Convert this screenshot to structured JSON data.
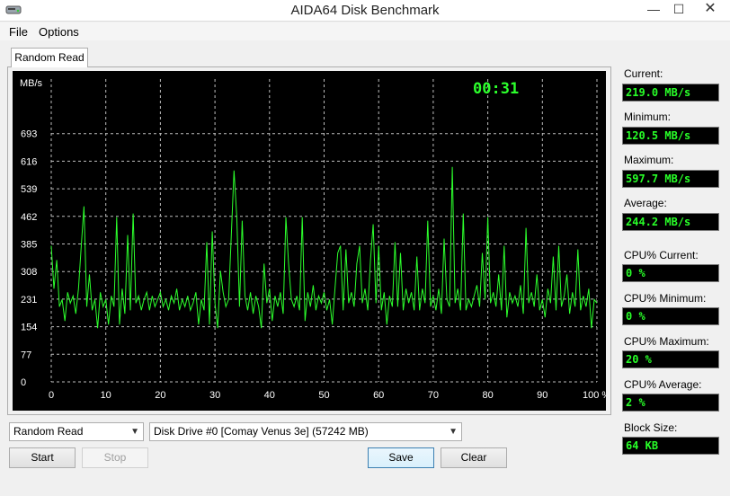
{
  "window": {
    "title": "AIDA64 Disk Benchmark",
    "minimize_glyph": "—",
    "maximize_glyph": "☐",
    "close_glyph": "✕"
  },
  "menu": {
    "items": [
      "File",
      "Options"
    ]
  },
  "tab": {
    "label": "Random Read"
  },
  "chart_data": {
    "type": "line",
    "timer": "00:31",
    "ylabel": "MB/s",
    "y_ticks": [
      "693",
      "616",
      "539",
      "462",
      "385",
      "308",
      "231",
      "154",
      "77",
      "0"
    ],
    "x_ticks": [
      "0",
      "10",
      "20",
      "30",
      "40",
      "50",
      "60",
      "70",
      "80",
      "90",
      "100 %"
    ],
    "xlim": [
      0,
      100
    ],
    "ylim": [
      0,
      770
    ],
    "grid": true,
    "line_color": "#2cff2c",
    "series": [
      {
        "values": [
          [
            0.0,
            380
          ],
          [
            0.5,
            260
          ],
          [
            1.0,
            340
          ],
          [
            1.5,
            210
          ],
          [
            2.0,
            230
          ],
          [
            2.5,
            170
          ],
          [
            3.0,
            250
          ],
          [
            3.5,
            220
          ],
          [
            4.0,
            240
          ],
          [
            4.5,
            190
          ],
          [
            5.0,
            260
          ],
          [
            5.5,
            380
          ],
          [
            6.0,
            490
          ],
          [
            6.5,
            210
          ],
          [
            7.0,
            300
          ],
          [
            7.5,
            200
          ],
          [
            8.0,
            230
          ],
          [
            8.5,
            150
          ],
          [
            9.0,
            250
          ],
          [
            9.5,
            210
          ],
          [
            10.0,
            230
          ],
          [
            10.5,
            160
          ],
          [
            11.0,
            240
          ],
          [
            11.5,
            210
          ],
          [
            12.0,
            460
          ],
          [
            12.5,
            160
          ],
          [
            13.0,
            260
          ],
          [
            13.5,
            190
          ],
          [
            14.0,
            410
          ],
          [
            14.5,
            200
          ],
          [
            15.0,
            470
          ],
          [
            15.5,
            220
          ],
          [
            16.0,
            240
          ],
          [
            16.5,
            200
          ],
          [
            17.0,
            230
          ],
          [
            17.5,
            250
          ],
          [
            18.0,
            200
          ],
          [
            18.5,
            240
          ],
          [
            19.0,
            210
          ],
          [
            19.5,
            230
          ],
          [
            20.0,
            250
          ],
          [
            20.5,
            210
          ],
          [
            21.0,
            230
          ],
          [
            21.5,
            200
          ],
          [
            22.0,
            240
          ],
          [
            22.5,
            220
          ],
          [
            23.0,
            260
          ],
          [
            23.5,
            200
          ],
          [
            24.0,
            230
          ],
          [
            24.5,
            210
          ],
          [
            25.0,
            240
          ],
          [
            25.5,
            200
          ],
          [
            26.0,
            220
          ],
          [
            26.5,
            250
          ],
          [
            27.0,
            160
          ],
          [
            27.5,
            230
          ],
          [
            28.0,
            200
          ],
          [
            28.5,
            390
          ],
          [
            29.0,
            160
          ],
          [
            29.5,
            420
          ],
          [
            30.0,
            220
          ],
          [
            30.5,
            150
          ],
          [
            31.0,
            310
          ],
          [
            31.5,
            250
          ],
          [
            32.0,
            210
          ],
          [
            32.5,
            230
          ],
          [
            33.0,
            410
          ],
          [
            33.5,
            590
          ],
          [
            34.0,
            460
          ],
          [
            34.5,
            210
          ],
          [
            35.0,
            450
          ],
          [
            35.5,
            240
          ],
          [
            36.0,
            200
          ],
          [
            36.5,
            250
          ],
          [
            37.0,
            190
          ],
          [
            37.5,
            240
          ],
          [
            38.0,
            210
          ],
          [
            38.5,
            150
          ],
          [
            39.0,
            330
          ],
          [
            39.5,
            220
          ],
          [
            40.0,
            260
          ],
          [
            40.5,
            170
          ],
          [
            41.0,
            240
          ],
          [
            41.5,
            210
          ],
          [
            42.0,
            250
          ],
          [
            42.5,
            190
          ],
          [
            43.0,
            460
          ],
          [
            43.5,
            330
          ],
          [
            44.0,
            230
          ],
          [
            44.5,
            210
          ],
          [
            45.0,
            240
          ],
          [
            45.5,
            200
          ],
          [
            46.0,
            460
          ],
          [
            46.5,
            170
          ],
          [
            47.0,
            250
          ],
          [
            47.5,
            210
          ],
          [
            48.0,
            270
          ],
          [
            48.5,
            200
          ],
          [
            49.0,
            240
          ],
          [
            49.5,
            220
          ],
          [
            50.0,
            250
          ],
          [
            50.5,
            200
          ],
          [
            51.0,
            230
          ],
          [
            51.5,
            160
          ],
          [
            52.0,
            260
          ],
          [
            52.5,
            360
          ],
          [
            53.0,
            380
          ],
          [
            53.5,
            200
          ],
          [
            54.0,
            370
          ],
          [
            54.5,
            220
          ],
          [
            55.0,
            250
          ],
          [
            55.5,
            210
          ],
          [
            56.0,
            330
          ],
          [
            56.5,
            380
          ],
          [
            57.0,
            220
          ],
          [
            57.5,
            260
          ],
          [
            58.0,
            200
          ],
          [
            58.5,
            340
          ],
          [
            59.0,
            440
          ],
          [
            59.5,
            220
          ],
          [
            60.0,
            380
          ],
          [
            60.5,
            200
          ],
          [
            61.0,
            250
          ],
          [
            61.5,
            160
          ],
          [
            62.0,
            240
          ],
          [
            62.5,
            210
          ],
          [
            63.0,
            390
          ],
          [
            63.5,
            210
          ],
          [
            64.0,
            360
          ],
          [
            64.5,
            200
          ],
          [
            65.0,
            260
          ],
          [
            65.5,
            220
          ],
          [
            66.0,
            250
          ],
          [
            66.5,
            200
          ],
          [
            67.0,
            350
          ],
          [
            67.5,
            200
          ],
          [
            68.0,
            260
          ],
          [
            68.5,
            220
          ],
          [
            69.0,
            450
          ],
          [
            69.5,
            210
          ],
          [
            70.0,
            240
          ],
          [
            70.5,
            200
          ],
          [
            71.0,
            260
          ],
          [
            71.5,
            190
          ],
          [
            72.0,
            400
          ],
          [
            72.5,
            230
          ],
          [
            73.0,
            210
          ],
          [
            73.5,
            600
          ],
          [
            74.0,
            220
          ],
          [
            74.5,
            260
          ],
          [
            75.0,
            200
          ],
          [
            75.5,
            470
          ],
          [
            76.0,
            200
          ],
          [
            76.5,
            230
          ],
          [
            77.0,
            210
          ],
          [
            77.5,
            240
          ],
          [
            78.0,
            270
          ],
          [
            78.5,
            210
          ],
          [
            79.0,
            360
          ],
          [
            79.5,
            230
          ],
          [
            80.0,
            460
          ],
          [
            80.5,
            220
          ],
          [
            81.0,
            250
          ],
          [
            81.5,
            210
          ],
          [
            82.0,
            300
          ],
          [
            82.5,
            200
          ],
          [
            83.0,
            380
          ],
          [
            83.5,
            180
          ],
          [
            84.0,
            250
          ],
          [
            84.5,
            220
          ],
          [
            85.0,
            240
          ],
          [
            85.5,
            210
          ],
          [
            86.0,
            270
          ],
          [
            86.5,
            190
          ],
          [
            87.0,
            430
          ],
          [
            87.5,
            220
          ],
          [
            88.0,
            250
          ],
          [
            88.5,
            210
          ],
          [
            89.0,
            300
          ],
          [
            89.5,
            200
          ],
          [
            90.0,
            230
          ],
          [
            90.5,
            180
          ],
          [
            91.0,
            260
          ],
          [
            91.5,
            220
          ],
          [
            92.0,
            350
          ],
          [
            92.5,
            200
          ],
          [
            93.0,
            380
          ],
          [
            93.5,
            210
          ],
          [
            94.0,
            240
          ],
          [
            94.5,
            300
          ],
          [
            95.0,
            190
          ],
          [
            95.5,
            250
          ],
          [
            96.0,
            210
          ],
          [
            96.5,
            370
          ],
          [
            97.0,
            200
          ],
          [
            97.5,
            240
          ],
          [
            98.0,
            210
          ],
          [
            98.5,
            260
          ],
          [
            99.0,
            150
          ],
          [
            99.5,
            230
          ],
          [
            100.0,
            220
          ]
        ]
      }
    ]
  },
  "stats": {
    "current_label": "Current:",
    "current_value": "219.0 MB/s",
    "minimum_label": "Minimum:",
    "minimum_value": "120.5 MB/s",
    "maximum_label": "Maximum:",
    "maximum_value": "597.7 MB/s",
    "average_label": "Average:",
    "average_value": "244.2 MB/s",
    "cpu_current_label": "CPU% Current:",
    "cpu_current_value": "0 %",
    "cpu_minimum_label": "CPU% Minimum:",
    "cpu_minimum_value": "0 %",
    "cpu_maximum_label": "CPU% Maximum:",
    "cpu_maximum_value": "20 %",
    "cpu_average_label": "CPU% Average:",
    "cpu_average_value": "2 %",
    "block_size_label": "Block Size:",
    "block_size_value": "64 KB"
  },
  "controls": {
    "test_select": "Random Read",
    "drive_select": "Disk Drive #0  [Comay Venus 3e]  (57242 MB)",
    "dropdown_arrow": "▼",
    "start_label": "Start",
    "stop_label": "Stop",
    "save_label": "Save",
    "clear_label": "Clear"
  }
}
